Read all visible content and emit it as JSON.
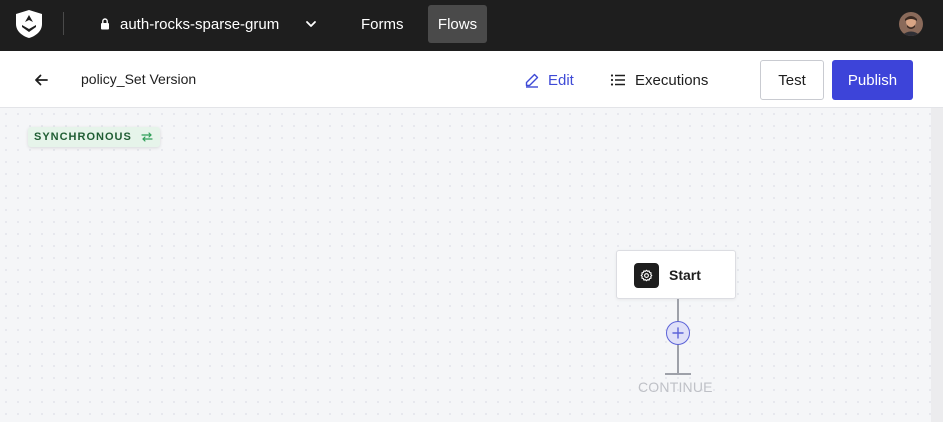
{
  "topbar": {
    "logo_icon": "shield-logo-icon",
    "tenant_name": "auth-rocks-sparse-grum",
    "tenant_lock_icon": "lock-icon",
    "tenant_dropdown_icon": "chevron-down-icon",
    "nav": [
      {
        "label": "Forms",
        "active": false
      },
      {
        "label": "Flows",
        "active": true
      }
    ],
    "avatar_icon": "user-avatar"
  },
  "subheader": {
    "back_icon": "arrow-left-icon",
    "title": "policy_Set Version",
    "tabs": [
      {
        "label": "Edit",
        "icon": "pencil-icon",
        "active": true
      },
      {
        "label": "Executions",
        "icon": "list-icon",
        "active": false
      }
    ],
    "test_label": "Test",
    "publish_label": "Publish"
  },
  "canvas": {
    "mode_badge": "SYNCHRONOUS",
    "mode_badge_icon": "sync-arrows-icon",
    "start_node_label": "Start",
    "start_node_icon": "gear-icon",
    "add_node_icon": "plus-icon",
    "continue_label": "CONTINUE"
  },
  "colors": {
    "topbar_bg": "#1e1e1e",
    "accent": "#3d44d9",
    "badge_bg": "#e6f4ea",
    "badge_text": "#1f5d33"
  }
}
